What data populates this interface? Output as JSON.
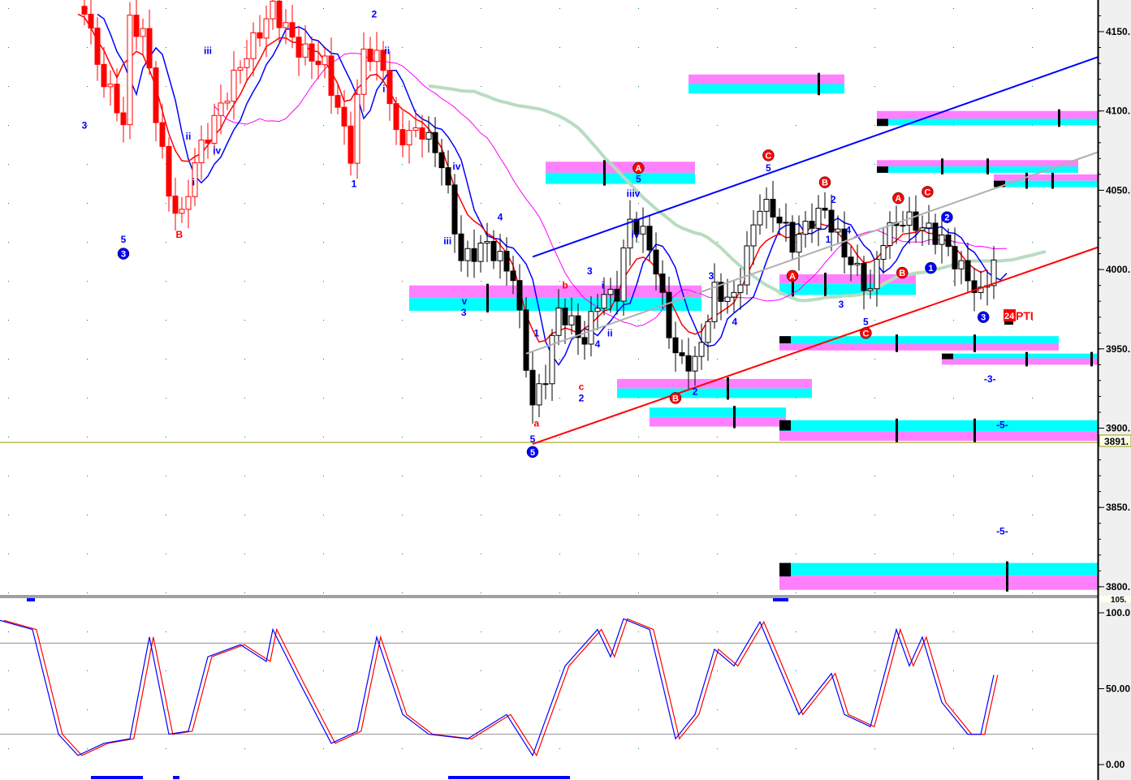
{
  "chart_data": {
    "type": "candlestick",
    "price_axis": {
      "ticks": [
        "4150.",
        "4100.",
        "4050.",
        "4000.",
        "3950.",
        "3900.",
        "3850.",
        "3800."
      ],
      "tick_values": [
        4150,
        4100,
        4050,
        4000,
        3950,
        3900,
        3850,
        3800
      ],
      "ylim": [
        3800,
        4167
      ]
    },
    "last_price_label": "3891.",
    "last_price": 3891,
    "osc_axis": {
      "ticks": [
        "100.0",
        "50.00",
        "0.00"
      ],
      "tick_values": [
        100,
        50,
        0
      ],
      "top_label": "105.",
      "levels": [
        80,
        20
      ]
    },
    "price_path": [
      [
        13,
        4167
      ],
      [
        15,
        4129
      ],
      [
        19,
        4093
      ],
      [
        20,
        4155
      ],
      [
        22,
        4150
      ],
      [
        26,
        4047
      ],
      [
        28,
        4032
      ],
      [
        30,
        4068
      ],
      [
        34,
        4103
      ],
      [
        37,
        4129
      ],
      [
        42,
        4165
      ],
      [
        46,
        4139
      ],
      [
        50,
        4129
      ],
      [
        54,
        4073
      ],
      [
        56,
        4139
      ],
      [
        59,
        4129
      ],
      [
        61,
        4083
      ],
      [
        65,
        4088
      ],
      [
        68,
        4068
      ],
      [
        71,
        4006
      ],
      [
        75,
        4016
      ],
      [
        79,
        3996
      ],
      [
        82,
        3914
      ],
      [
        84,
        3934
      ],
      [
        86,
        3975
      ],
      [
        90,
        3955
      ],
      [
        92,
        3981
      ],
      [
        95,
        3986
      ],
      [
        97,
        4032
      ],
      [
        100,
        4016
      ],
      [
        104,
        3945
      ],
      [
        107,
        3940
      ],
      [
        110,
        3986
      ],
      [
        113,
        3981
      ],
      [
        117,
        4042
      ],
      [
        120,
        4032
      ],
      [
        122,
        4016
      ],
      [
        125,
        4032
      ],
      [
        127,
        4037
      ],
      [
        130,
        4011
      ],
      [
        134,
        3986
      ],
      [
        136,
        4021
      ],
      [
        139,
        4032
      ],
      [
        142,
        4027
      ],
      [
        145,
        4019
      ],
      [
        147,
        4006
      ],
      [
        151,
        3983
      ],
      [
        153,
        4006
      ]
    ],
    "oscillator": [
      [
        0,
        95
      ],
      [
        5,
        89
      ],
      [
        9,
        20
      ],
      [
        12,
        6
      ],
      [
        16,
        14
      ],
      [
        20,
        17
      ],
      [
        23,
        84
      ],
      [
        26,
        20
      ],
      [
        29,
        22
      ],
      [
        32,
        71
      ],
      [
        37,
        79
      ],
      [
        41,
        68
      ],
      [
        42,
        89
      ],
      [
        46,
        55
      ],
      [
        51,
        14
      ],
      [
        55,
        22
      ],
      [
        58,
        84
      ],
      [
        62,
        33
      ],
      [
        66,
        20
      ],
      [
        72,
        17
      ],
      [
        78,
        33
      ],
      [
        82,
        6
      ],
      [
        87,
        65
      ],
      [
        92,
        89
      ],
      [
        94,
        71
      ],
      [
        96,
        96
      ],
      [
        100,
        89
      ],
      [
        104,
        17
      ],
      [
        107,
        33
      ],
      [
        110,
        76
      ],
      [
        113,
        65
      ],
      [
        117,
        94
      ],
      [
        123,
        33
      ],
      [
        128,
        60
      ],
      [
        130,
        33
      ],
      [
        134,
        25
      ],
      [
        138,
        89
      ],
      [
        140,
        65
      ],
      [
        142,
        84
      ],
      [
        145,
        41
      ],
      [
        149,
        20
      ],
      [
        151,
        20
      ],
      [
        153,
        59
      ]
    ],
    "trendlines": [
      {
        "name": "upper-channel",
        "color": "#0000ff",
        "from": [
          82,
          4008
        ],
        "to": [
          169,
          4134
        ]
      },
      {
        "name": "lower-channel",
        "color": "#ff0000",
        "from": [
          82,
          3890
        ],
        "to": [
          169,
          4014
        ]
      },
      {
        "name": "mid-line",
        "color": "#b0b0b0",
        "from": [
          81,
          3947
        ],
        "to": [
          169,
          4074
        ]
      }
    ],
    "zones": [
      {
        "from": 106,
        "to": 130,
        "pink": [
          4123,
          4117
        ],
        "cyan": [
          4117,
          4111
        ],
        "ticks": [
          126
        ]
      },
      {
        "from": 135,
        "to": 169,
        "pink": [
          4100,
          4095
        ],
        "cyan": [
          4095,
          4091
        ],
        "ticks": [
          163
        ],
        "black": true
      },
      {
        "from": 84,
        "to": 107,
        "pink": [
          4068,
          4061
        ],
        "cyan": [
          4061,
          4054
        ],
        "ticks": [
          93
        ]
      },
      {
        "from": 135,
        "to": 166,
        "pink": [
          4069,
          4065
        ],
        "cyan": [
          4065,
          4061
        ],
        "ticks": [
          145,
          152
        ],
        "black": true
      },
      {
        "from": 153,
        "to": 169,
        "pink": [
          4060,
          4056
        ],
        "cyan": [
          4056,
          4052
        ],
        "ticks": [
          158,
          162
        ],
        "black": true
      },
      {
        "from": 63,
        "to": 108,
        "pink": [
          3990,
          3982
        ],
        "cyan": [
          3982,
          3974
        ],
        "ticks": [
          75
        ]
      },
      {
        "from": 120,
        "to": 141,
        "pink": [
          3997,
          3991
        ],
        "cyan": [
          3991,
          3984
        ],
        "ticks": [
          122,
          127
        ]
      },
      {
        "from": 120,
        "to": 163,
        "pink": [
          3953,
          3949
        ],
        "cyan": [
          3958,
          3953
        ],
        "ticks": [
          138,
          150
        ],
        "black": true
      },
      {
        "from": 145,
        "to": 169,
        "pink": [
          3944,
          3940
        ],
        "cyan": [
          3947,
          3944
        ],
        "ticks": [
          158,
          168
        ],
        "black": true
      },
      {
        "from": 95,
        "to": 125,
        "pink": [
          3931,
          3925
        ],
        "cyan": [
          3925,
          3919
        ],
        "ticks": [
          112
        ]
      },
      {
        "from": 100,
        "to": 121,
        "pink": [
          3907,
          3901
        ],
        "cyan": [
          3913,
          3907
        ],
        "ticks": [
          113
        ]
      },
      {
        "from": 120,
        "to": 169,
        "pink": [
          3898,
          3892
        ],
        "cyan": [
          3905,
          3898
        ],
        "ticks": [
          138,
          150
        ],
        "black": true
      },
      {
        "from": 120,
        "to": 169,
        "pink": [
          3807,
          3798
        ],
        "cyan": [
          3815,
          3807
        ],
        "ticks": [
          155
        ],
        "black": true
      }
    ],
    "wave_labels": [
      {
        "b": 13,
        "p": 4091,
        "t": "3",
        "c": "#0000ff"
      },
      {
        "b": 19,
        "p": 4019,
        "t": "5",
        "c": "#0000ff"
      },
      {
        "b": 19,
        "p": 4010,
        "t": "3",
        "c": "#0000ff",
        "circle": true
      },
      {
        "b": 27.6,
        "p": 4022,
        "t": "B",
        "c": "#ff0000"
      },
      {
        "b": 32,
        "p": 4138,
        "t": "iii",
        "c": "#0000ff"
      },
      {
        "b": 33.4,
        "p": 4075,
        "t": "iv",
        "c": "#0000ff"
      },
      {
        "b": 29,
        "p": 4084,
        "t": "ii",
        "c": "#0000ff"
      },
      {
        "b": 29.8,
        "p": 4055,
        "t": "i",
        "c": "#0000ff"
      },
      {
        "b": 57.6,
        "p": 4161,
        "t": "2",
        "c": "#0000ff"
      },
      {
        "b": 59.6,
        "p": 4138,
        "t": "ii",
        "c": "#0000ff"
      },
      {
        "b": 59.1,
        "p": 4114,
        "t": "i",
        "c": "#0000ff"
      },
      {
        "b": 54.5,
        "p": 4054,
        "t": "1",
        "c": "#0000ff"
      },
      {
        "b": 70.3,
        "p": 4065,
        "t": "iv",
        "c": "#0000ff"
      },
      {
        "b": 68.9,
        "p": 4018,
        "t": "iii",
        "c": "#0000ff"
      },
      {
        "b": 77,
        "p": 4033,
        "t": "4",
        "c": "#0000ff"
      },
      {
        "b": 71.5,
        "p": 3980,
        "t": "v",
        "c": "#0000ff"
      },
      {
        "b": 71.4,
        "p": 3973,
        "t": "3",
        "c": "#0000ff"
      },
      {
        "b": 82.6,
        "p": 3960,
        "t": "1",
        "c": "#0000ff"
      },
      {
        "b": 87,
        "p": 3990,
        "t": "b",
        "c": "#ff0000"
      },
      {
        "b": 82,
        "p": 3893,
        "t": "5",
        "c": "#0000ff"
      },
      {
        "b": 82,
        "p": 3885,
        "t": "5",
        "c": "#0000ff",
        "circle": true
      },
      {
        "b": 82.6,
        "p": 3903,
        "t": "a",
        "c": "#ff0000"
      },
      {
        "b": 90.8,
        "p": 3999,
        "t": "3",
        "c": "#0000ff"
      },
      {
        "b": 92.8,
        "p": 3990,
        "t": "i",
        "c": "#0000ff"
      },
      {
        "b": 92,
        "p": 3953,
        "t": "4",
        "c": "#0000ff"
      },
      {
        "b": 93.9,
        "p": 3960,
        "t": "ii",
        "c": "#0000ff"
      },
      {
        "b": 89.5,
        "p": 3926,
        "t": "c",
        "c": "#ff0000"
      },
      {
        "b": 89.5,
        "p": 3919,
        "t": "2",
        "c": "#0000ff"
      },
      {
        "b": 98.3,
        "p": 4064,
        "t": "A",
        "c": "#ff0000",
        "circle": true
      },
      {
        "b": 98.3,
        "p": 4057,
        "t": "5",
        "c": "#0000ff"
      },
      {
        "b": 97.5,
        "p": 4048,
        "t": "iiiv",
        "c": "#0000ff"
      },
      {
        "b": 97.8,
        "p": 4022,
        "t": "iv",
        "c": "#0000ff"
      },
      {
        "b": 104,
        "p": 3919,
        "t": "B",
        "c": "#ff0000",
        "circle": true
      },
      {
        "b": 107,
        "p": 3923,
        "t": "2",
        "c": "#0000ff"
      },
      {
        "b": 109.5,
        "p": 3996,
        "t": "3",
        "c": "#0000ff"
      },
      {
        "b": 113.1,
        "p": 3967,
        "t": "4",
        "c": "#0000ff"
      },
      {
        "b": 118.3,
        "p": 4072,
        "t": "C",
        "c": "#ff0000",
        "circle": true
      },
      {
        "b": 118.3,
        "p": 4064,
        "t": "5",
        "c": "#0000ff"
      },
      {
        "b": 127,
        "p": 4055,
        "t": "B",
        "c": "#ff0000",
        "circle": true
      },
      {
        "b": 128.3,
        "p": 4044,
        "t": "2",
        "c": "#0000ff"
      },
      {
        "b": 127.5,
        "p": 4019,
        "t": "1",
        "c": "#0000ff"
      },
      {
        "b": 130.6,
        "p": 4025,
        "t": "4",
        "c": "#0000ff"
      },
      {
        "b": 129.5,
        "p": 3978,
        "t": "3",
        "c": "#0000ff"
      },
      {
        "b": 133.3,
        "p": 3967,
        "t": "5",
        "c": "#0000ff"
      },
      {
        "b": 133.3,
        "p": 3960,
        "t": "C",
        "c": "#ff0000",
        "circle": true
      },
      {
        "b": 122,
        "p": 3996,
        "t": "A",
        "c": "#ff0000",
        "circle": true
      },
      {
        "b": 138.3,
        "p": 4045,
        "t": "A",
        "c": "#ff0000",
        "circle": true
      },
      {
        "b": 142.8,
        "p": 4049,
        "t": "C",
        "c": "#ff0000",
        "circle": true
      },
      {
        "b": 138.9,
        "p": 3998,
        "t": "B",
        "c": "#ff0000",
        "circle": true
      },
      {
        "b": 143.3,
        "p": 4001,
        "t": "1",
        "c": "#0000ff",
        "circle": true
      },
      {
        "b": 145.8,
        "p": 4033,
        "t": "2",
        "c": "#0000ff",
        "circle": true
      },
      {
        "b": 151.4,
        "p": 3970,
        "t": "3",
        "c": "#0000ff",
        "circle": true
      },
      {
        "b": 152.4,
        "p": 3931,
        "t": "-3-",
        "c": "#0000ff"
      },
      {
        "b": 154.3,
        "p": 3902,
        "t": "-5-",
        "c": "#0000ff"
      },
      {
        "b": 154.3,
        "p": 3835,
        "t": "-5-",
        "c": "#0000ff"
      }
    ],
    "annotation": {
      "box": "24",
      "text": "PTI",
      "color": "#ff0000"
    }
  }
}
